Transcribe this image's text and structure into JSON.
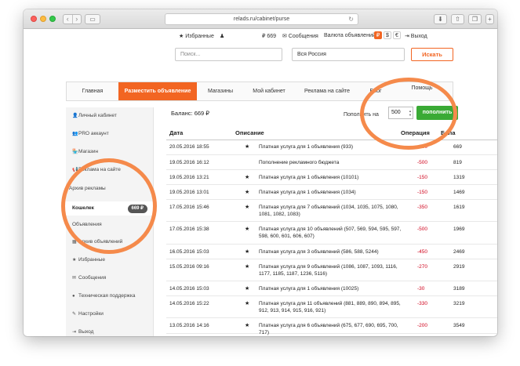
{
  "browser": {
    "url": "relads.ru/cabinet/purse",
    "reload_icon": "reload-icon"
  },
  "topbar": {
    "favorites": "★ Избранные",
    "user_icon": "user-icon",
    "balance": "₽ 669",
    "messages": "✉ Сообщения",
    "currency_label": "Валюта объявлений:",
    "currencies": [
      "₽",
      "$",
      "€"
    ],
    "logout": "⇥ Выход"
  },
  "search": {
    "query_placeholder": "Поиск...",
    "region": "Вся Россия",
    "button": "Искать"
  },
  "nav": {
    "tabs": [
      "Главная",
      "Разместить объявление",
      "Магазины",
      "Мой кабинет",
      "Реклама на сайте",
      "Блог",
      "Помощь"
    ]
  },
  "sidebar": {
    "items": [
      {
        "icon": "👤",
        "label": "Личный кабинет"
      },
      {
        "icon": "👥",
        "label": "PRO аккаунт"
      },
      {
        "icon": "🏪",
        "label": "Магазин"
      },
      {
        "icon": "📢",
        "label": "Реклама на сайте"
      },
      {
        "icon": "",
        "label": "Архив рекламы"
      },
      {
        "icon": "",
        "label": "Кошелек",
        "badge": "669 ₽"
      },
      {
        "icon": "",
        "label": "Объявления"
      },
      {
        "icon": "▦",
        "label": "Архив объявлений"
      },
      {
        "icon": "★",
        "label": "Избранные"
      },
      {
        "icon": "✉",
        "label": "Сообщения"
      },
      {
        "icon": "●",
        "label": "Техническая поддержка"
      },
      {
        "icon": "✎",
        "label": "Настройки"
      },
      {
        "icon": "⇥",
        "label": "Выход"
      }
    ]
  },
  "purse": {
    "balance": "Баланс: 669 ₽",
    "topup_label": "Пополнить на",
    "amount": "500",
    "topup_button": "пополнить"
  },
  "table": {
    "headers": {
      "date": "Дата",
      "description": "Описание",
      "operation": "Операция",
      "balance": "Бала"
    },
    "rows": [
      {
        "date": "20.05.2016 18:55",
        "star": "★",
        "desc": "Платная услуга для 1 объявления (933)",
        "op": "-150",
        "bal": "669"
      },
      {
        "date": "19.05.2016 16:12",
        "star": "",
        "desc": "Пополнение рекламного бюджета",
        "op": "-500",
        "bal": "819"
      },
      {
        "date": "19.05.2016 13:21",
        "star": "★",
        "desc": "Платная услуга для 1 объявления (10101)",
        "op": "-150",
        "bal": "1319"
      },
      {
        "date": "19.05.2016 13:01",
        "star": "★",
        "desc": "Платная услуга для 1 объявления (1034)",
        "op": "-150",
        "bal": "1469"
      },
      {
        "date": "17.05.2016 15:46",
        "star": "★",
        "desc": "Платная услуга для 7 объявлений (1034, 1035, 1075, 1080, 1081, 1082, 1083)",
        "op": "-350",
        "bal": "1619"
      },
      {
        "date": "17.05.2016 15:38",
        "star": "★",
        "desc": "Платная услуга для 10 объявлений (507, 569, 594, 595, 597, 598, 600, 601, 606, 607)",
        "op": "-500",
        "bal": "1969"
      },
      {
        "date": "16.05.2016 15:03",
        "star": "★",
        "desc": "Платная услуга для 3 объявлений (586, 588, 5244)",
        "op": "-450",
        "bal": "2469"
      },
      {
        "date": "15.05.2016 09:16",
        "star": "★",
        "desc": "Платная услуга для 9 объявлений (1086, 1087, 1093, 1116, 1177, 1185, 1187, 1236, 5116)",
        "op": "-270",
        "bal": "2919"
      },
      {
        "date": "14.05.2016 15:03",
        "star": "★",
        "desc": "Платная услуга для 1 объявления (10025)",
        "op": "-30",
        "bal": "3189"
      },
      {
        "date": "14.05.2016 15:22",
        "star": "★",
        "desc": "Платная услуга для 11 объявлений (881, 889, 890, 894, 895, 912, 913, 914, 915, 916, 921)",
        "op": "-330",
        "bal": "3219"
      },
      {
        "date": "13.05.2016 14:16",
        "star": "★",
        "desc": "Платная услуга для 6 объявлений (675, 677, 690, 695, 700, 717)",
        "op": "-200",
        "bal": "3549"
      }
    ]
  },
  "colors": {
    "accent": "#f26522",
    "topup": "#3aaa35",
    "negative": "#d0021b",
    "highlight_ring": "#f58a4b"
  }
}
